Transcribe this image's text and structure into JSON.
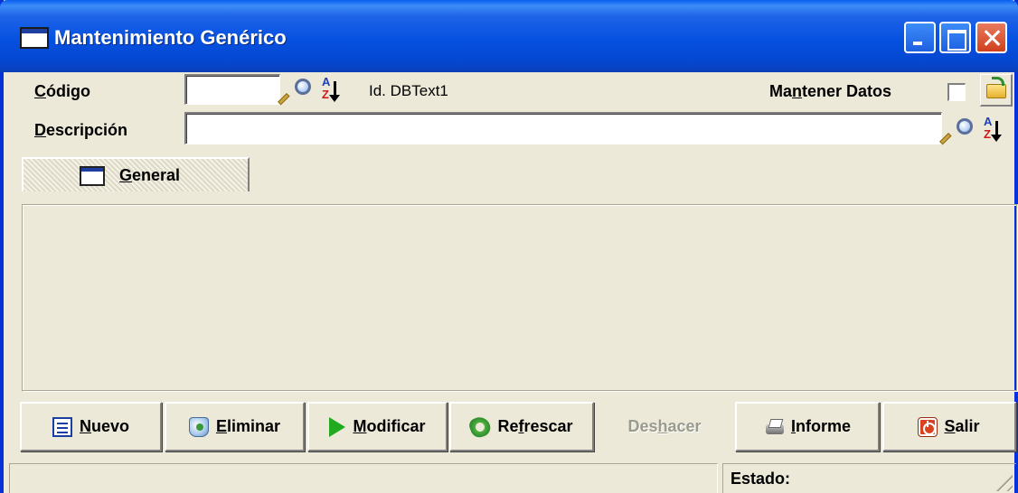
{
  "window": {
    "title": "Mantenimiento Genérico"
  },
  "form": {
    "codigo_label_first": "C",
    "codigo_label_rest": "ódigo",
    "codigo_value": "",
    "id_text": "Id. DBText1",
    "descripcion_label_first": "D",
    "descripcion_label_rest": "escripción",
    "descripcion_value": "",
    "mantener_pre": "Ma",
    "mantener_u": "n",
    "mantener_post": "tener Datos",
    "mantener_checked": false
  },
  "tabs": [
    {
      "label_u": "G",
      "label_rest": "eneral"
    }
  ],
  "buttons": {
    "nuevo_u": "N",
    "nuevo_rest": "uevo",
    "eliminar_u": "E",
    "eliminar_rest": "liminar",
    "modificar_u": "M",
    "modificar_rest": "odificar",
    "refrescar_pre": "Re",
    "refrescar_u": "f",
    "refrescar_post": "rescar",
    "deshacer_pre": "Des",
    "deshacer_u": "h",
    "deshacer_post": "acer",
    "informe_u": "I",
    "informe_rest": "nforme",
    "salir_u": "S",
    "salir_rest": "alir"
  },
  "icons": {
    "search": "magnifier-icon",
    "sort": "sort-az-icon",
    "folder": "folder-open-icon",
    "nuevo": "document-icon",
    "eliminar": "recycle-bin-icon",
    "modificar": "play-icon",
    "refrescar": "refresh-icon",
    "informe": "printer-icon",
    "salir": "exit-icon"
  },
  "status": {
    "left_text": "",
    "estado_label": "Estado:"
  },
  "colors": {
    "titlebar": "#0651E0",
    "face": "#ECE9D8",
    "close": "#D0401C"
  }
}
